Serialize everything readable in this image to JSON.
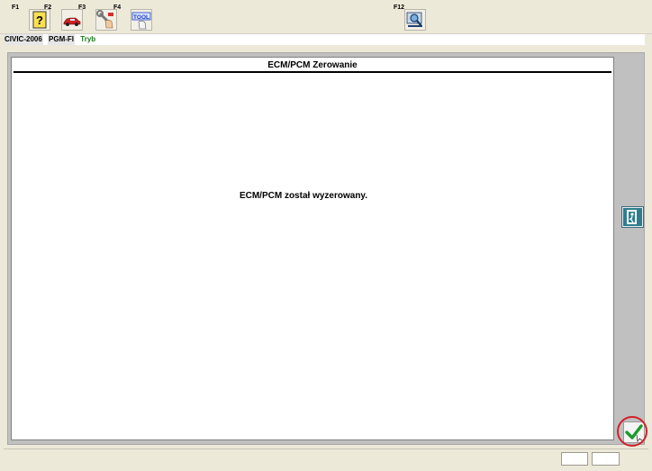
{
  "toolbar": {
    "keys": {
      "f1": "F1",
      "f2": "F2",
      "f3": "F3",
      "f4": "F4",
      "f12": "F12"
    },
    "icons": {
      "f1": "help-question-icon",
      "f2": "car-icon",
      "f3": "wrench-hand-icon",
      "f4": "tool-hand-icon",
      "f12": "magnifier-screen-icon"
    },
    "tool_text": "TOOL"
  },
  "info_bar": {
    "model": "CIVIC-2006",
    "system": "PGM-FI",
    "mode": "Tryb"
  },
  "panel": {
    "title": "ECM/PCM Zerowanie",
    "message": "ECM/PCM został wyzerowany."
  },
  "side_buttons": {
    "exit_icon": "exit-door-icon",
    "ok_icon": "checkmark-icon"
  },
  "colors": {
    "ok_highlight": "#d2202a",
    "mode_text": "#1a7a1a"
  }
}
